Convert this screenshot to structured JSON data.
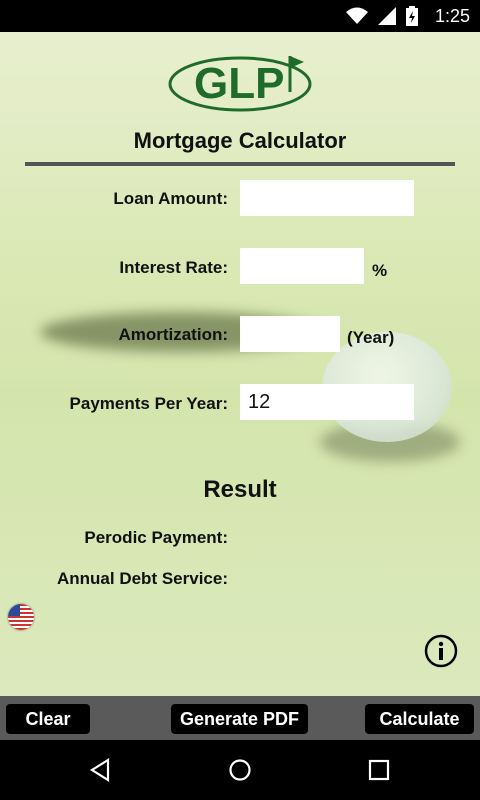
{
  "status_bar": {
    "time": "1:25"
  },
  "logo": {
    "text": "GLP"
  },
  "page_title": "Mortgage Calculator",
  "form": {
    "loan_amount": {
      "label": "Loan Amount:",
      "value": ""
    },
    "interest_rate": {
      "label": "Interest Rate:",
      "value": "",
      "suffix": "%"
    },
    "amortization": {
      "label": "Amortization:",
      "value": "",
      "suffix": "(Year)"
    },
    "payments_per_year": {
      "label": "Payments Per Year:",
      "value": "12"
    }
  },
  "result": {
    "title": "Result",
    "periodic_payment_label": "Perodic Payment:",
    "annual_debt_service_label": "Annual Debt Service:"
  },
  "buttons": {
    "clear": "Clear",
    "generate_pdf": "Generate PDF",
    "calculate": "Calculate"
  },
  "icons": {
    "flag": "us-flag-icon",
    "info": "info-icon",
    "wifi": "wifi-icon",
    "signal": "cell-signal-icon",
    "battery": "battery-icon"
  }
}
